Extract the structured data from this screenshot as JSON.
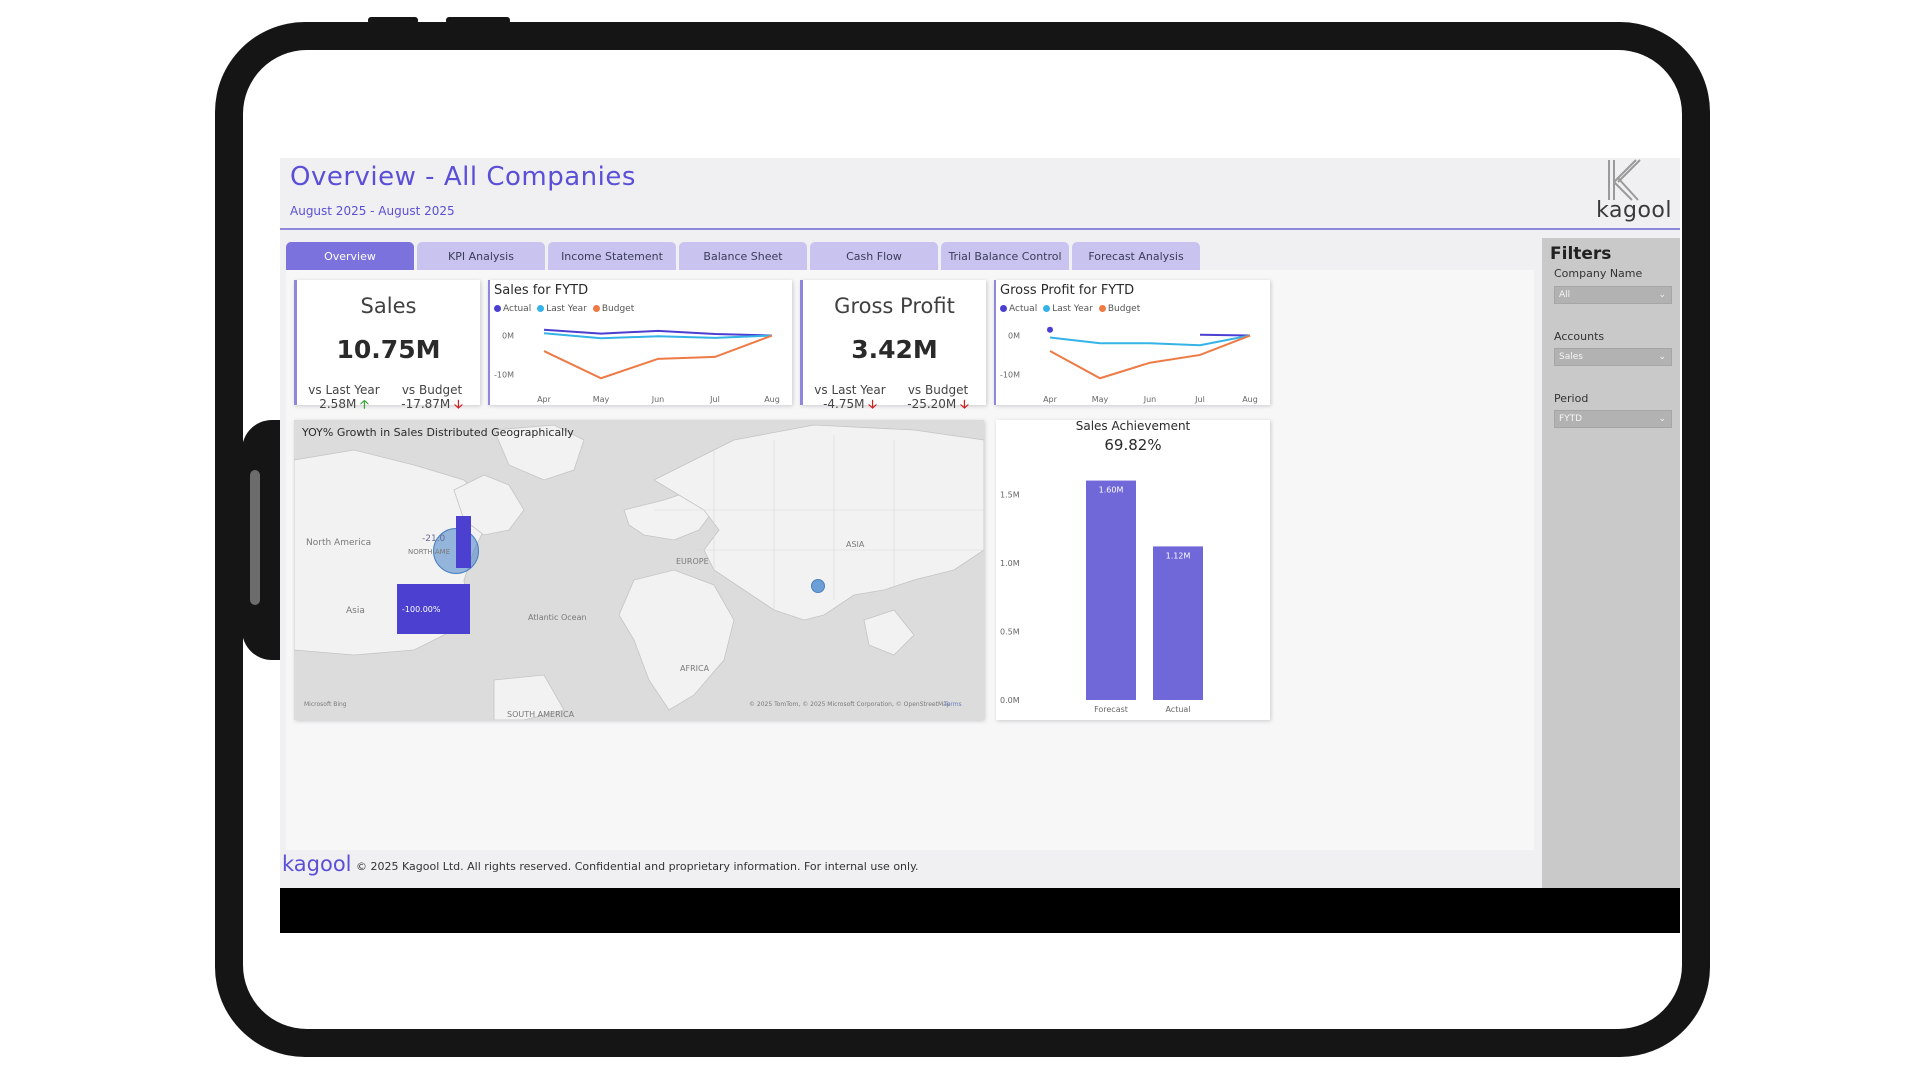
{
  "header": {
    "title": "Overview - All Companies",
    "subtitle": "August 2025 - August 2025",
    "logo_text": "kagool"
  },
  "tabs": [
    {
      "label": "Overview",
      "active": true
    },
    {
      "label": "KPI Analysis",
      "active": false
    },
    {
      "label": "Income Statement",
      "active": false
    },
    {
      "label": "Balance Sheet",
      "active": false
    },
    {
      "label": "Cash Flow",
      "active": false
    },
    {
      "label": "Trial Balance Control",
      "active": false
    },
    {
      "label": "Forecast Analysis",
      "active": false
    }
  ],
  "kpis": {
    "sales": {
      "title": "Sales",
      "value": "10.75M",
      "vs_last_year_label": "vs Last Year",
      "vs_last_year_value": "2.58M",
      "vs_last_year_trend": "up",
      "vs_budget_label": "vs Budget",
      "vs_budget_value": "-17.87M",
      "vs_budget_trend": "down"
    },
    "gross_profit": {
      "title": "Gross Profit",
      "value": "3.42M",
      "vs_last_year_label": "vs Last Year",
      "vs_last_year_value": "-4.75M",
      "vs_last_year_trend": "down",
      "vs_budget_label": "vs Budget",
      "vs_budget_value": "-25.20M",
      "vs_budget_trend": "down"
    }
  },
  "legend": {
    "actual": "Actual",
    "last_year": "Last Year",
    "budget": "Budget"
  },
  "colors": {
    "actual": "#4b3fd1",
    "last_year": "#35b3e6",
    "budget": "#ee7a45",
    "bar": "#7067d8",
    "accent": "#5a4fd6",
    "map_bar": "#4b40d0"
  },
  "chart_data": [
    {
      "type": "line",
      "title": "Sales for FYTD",
      "categories": [
        "Apr",
        "May",
        "Jun",
        "Jul",
        "Aug"
      ],
      "y_ticks": [
        "0M",
        "-10M"
      ],
      "ylim": [
        -13,
        4
      ],
      "series": [
        {
          "name": "Actual",
          "values": [
            1.5,
            0.5,
            1.2,
            0.4,
            0
          ]
        },
        {
          "name": "Last Year",
          "values": [
            0.6,
            -0.7,
            -0.2,
            -0.6,
            0
          ]
        },
        {
          "name": "Budget",
          "values": [
            -4,
            -11,
            -6,
            -5.5,
            0
          ]
        }
      ]
    },
    {
      "type": "line",
      "title": "Gross Profit for FYTD",
      "categories": [
        "Apr",
        "May",
        "Jun",
        "Jul",
        "Aug"
      ],
      "y_ticks": [
        "0M",
        "-10M"
      ],
      "ylim": [
        -13,
        4
      ],
      "series": [
        {
          "name": "Actual",
          "values": [
            1.5,
            null,
            null,
            0.2,
            0
          ]
        },
        {
          "name": "Last Year",
          "values": [
            -0.5,
            -2,
            -2,
            -2.5,
            0
          ]
        },
        {
          "name": "Budget",
          "values": [
            -4,
            -11,
            -7,
            -5,
            0
          ]
        }
      ]
    },
    {
      "type": "bar",
      "title": "Sales Achievement",
      "headline": "69.82%",
      "categories": [
        "Forecast",
        "Actual"
      ],
      "values": [
        1.6,
        1.12
      ],
      "value_labels": [
        "1.60M",
        "1.12M"
      ],
      "y_ticks": [
        "1.5M",
        "1.0M",
        "0.5M",
        "0.0M"
      ],
      "ylim": [
        0,
        1.75
      ]
    }
  ],
  "map": {
    "title": "YOY% Growth in Sales Distributed Geographically",
    "labels": {
      "north_america": "North America",
      "asia_left": "Asia",
      "atlantic": "Atlantic Ocean",
      "europe": "EUROPE",
      "asia": "ASIA",
      "africa": "AFRICA",
      "south_america": "SOUTH AMERICA",
      "north_america_caps": "NORTH AME",
      "growth_na": "-21.0",
      "growth_asia": "-100.00%"
    },
    "attribution": "© 2025 TomTom, © 2025 Microsoft Corporation, © OpenStreetMap",
    "terms": "Terms",
    "provider": "Microsoft Bing"
  },
  "filters": {
    "title": "Filters",
    "company_name_label": "Company Name",
    "company_name_value": "All",
    "accounts_label": "Accounts",
    "accounts_value": "Sales",
    "period_label": "Period",
    "period_value": "FYTD"
  },
  "footer": {
    "logo": "kagool",
    "text": "© 2025 Kagool Ltd. All rights reserved. Confidential and proprietary information. For internal use only."
  }
}
